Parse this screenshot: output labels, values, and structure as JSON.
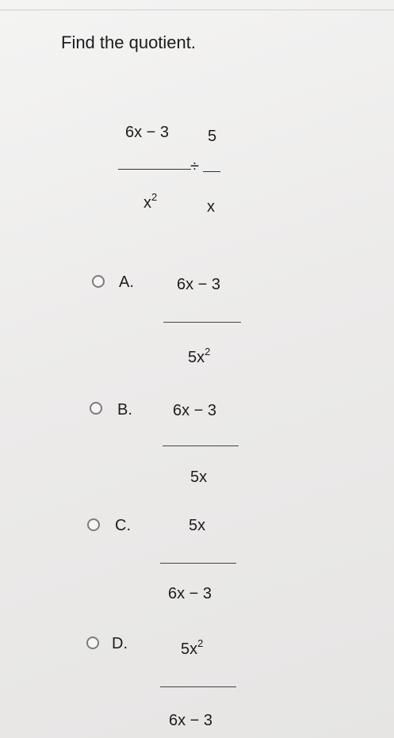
{
  "question": {
    "instruction": "Find the quotient.",
    "expression": {
      "term1_numerator": "6x − 3",
      "term1_denominator": "x",
      "term1_denominator_exp": "2",
      "operator": "÷",
      "term2_numerator": "5",
      "term2_denominator": "x"
    }
  },
  "choices": [
    {
      "letter": "A.",
      "numerator": "6x − 3",
      "numerator_exp": "",
      "denominator": "5x",
      "denominator_exp": "2"
    },
    {
      "letter": "B.",
      "numerator": "6x − 3",
      "numerator_exp": "",
      "denominator": "5x",
      "denominator_exp": ""
    },
    {
      "letter": "C.",
      "numerator": "5x",
      "numerator_exp": "",
      "denominator": "6x − 3",
      "denominator_exp": ""
    },
    {
      "letter": "D.",
      "numerator": "5x",
      "numerator_exp": "2",
      "denominator": "6x − 3",
      "denominator_exp": ""
    }
  ]
}
